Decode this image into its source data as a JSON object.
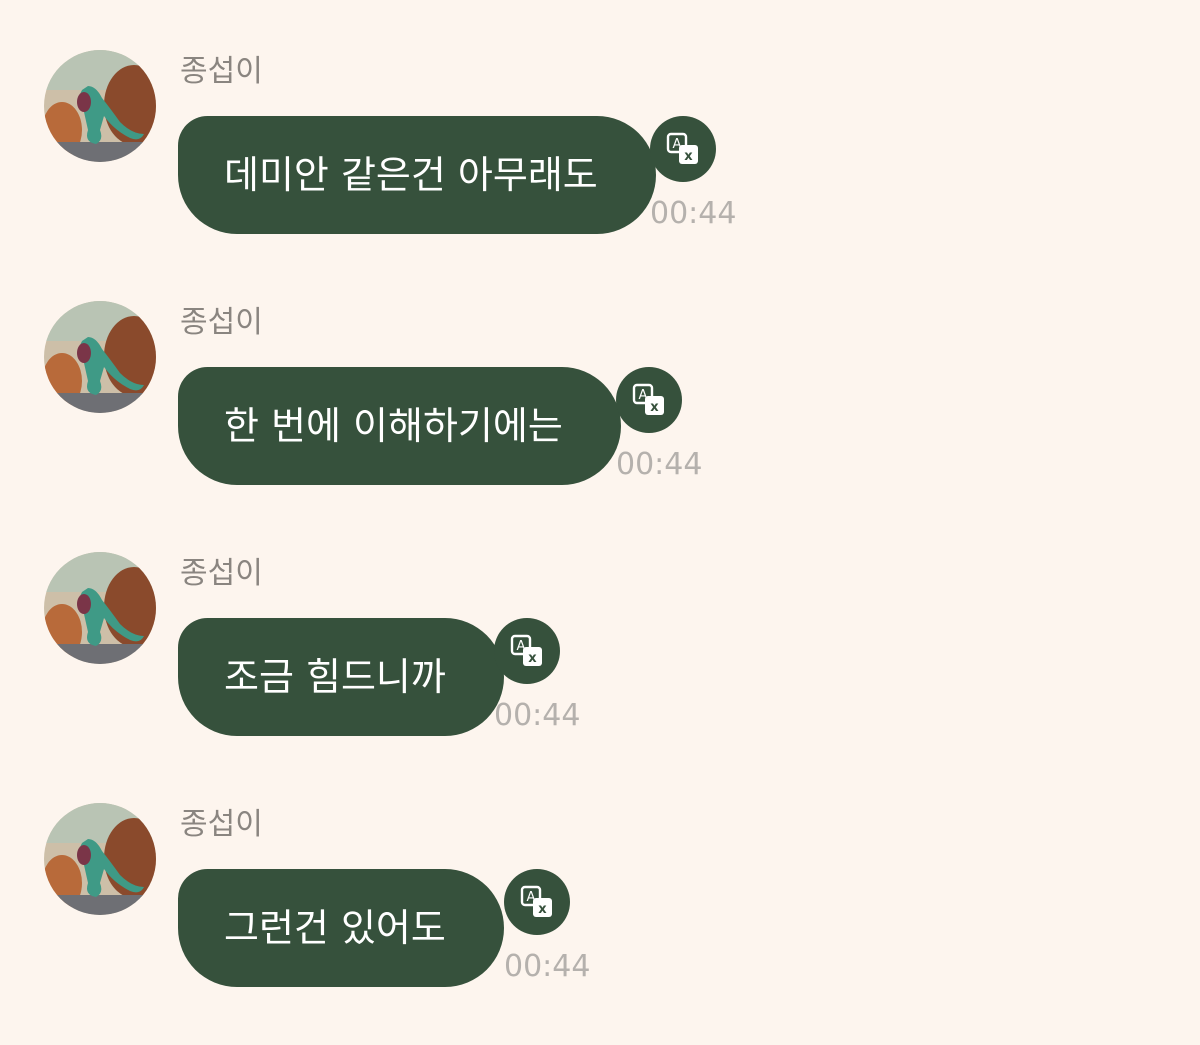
{
  "messages": [
    {
      "sender": "종섭이",
      "text": "데미안 같은건 아무래도",
      "time": "00:44",
      "translate_icon": "translate-icon",
      "avatar": "lizard-avatar"
    },
    {
      "sender": "종섭이",
      "text": "한 번에 이해하기에는",
      "time": "00:44",
      "translate_icon": "translate-icon",
      "avatar": "lizard-avatar"
    },
    {
      "sender": "종섭이",
      "text": "조금 힘드니까",
      "time": "00:44",
      "translate_icon": "translate-icon",
      "avatar": "lizard-avatar"
    },
    {
      "sender": "종섭이",
      "text": "그런건 있어도",
      "time": "00:44",
      "translate_icon": "translate-icon",
      "avatar": "lizard-avatar"
    }
  ],
  "colors": {
    "background": "#fdf5ee",
    "bubble": "#36513c",
    "bubble_text": "#ffffff",
    "sender_text": "#8a8580",
    "time_text": "#b5b1ad"
  }
}
